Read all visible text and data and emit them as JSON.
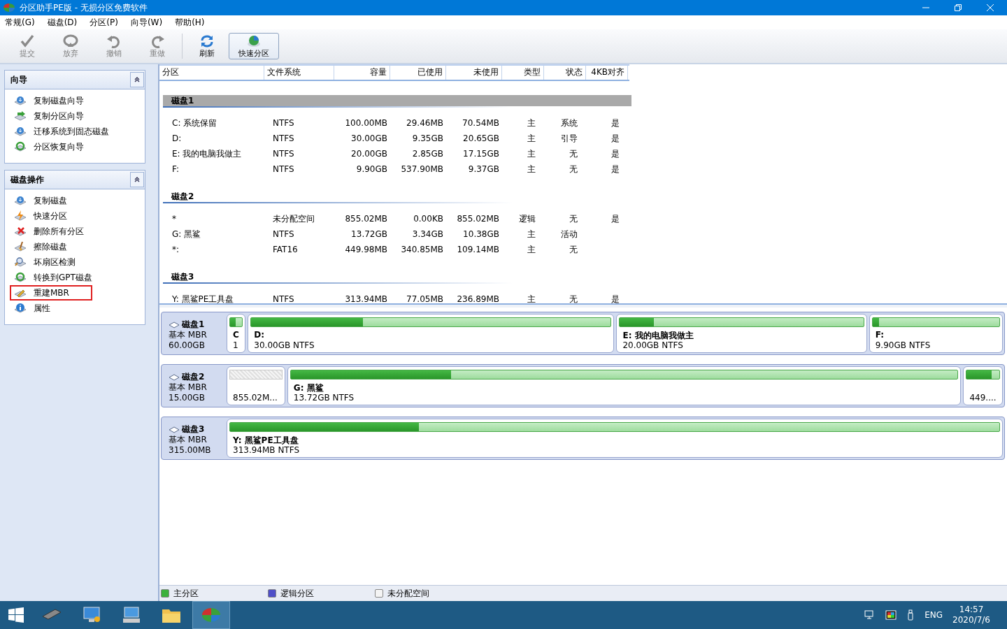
{
  "window": {
    "title": "分区助手PE版 - 无损分区免费软件"
  },
  "menu": [
    "常规(G)",
    "磁盘(D)",
    "分区(P)",
    "向导(W)",
    "帮助(H)"
  ],
  "toolbar": [
    {
      "label": "提交",
      "disabled": true,
      "hovered": false
    },
    {
      "label": "放弃",
      "disabled": true,
      "hovered": false
    },
    {
      "label": "撤销",
      "disabled": true,
      "hovered": false
    },
    {
      "label": "重做",
      "disabled": true,
      "hovered": false
    },
    {
      "label": "刷新",
      "disabled": false,
      "hovered": false
    },
    {
      "label": "快速分区",
      "disabled": false,
      "hovered": true
    }
  ],
  "sidebar": [
    {
      "title": "向导",
      "expanded": true,
      "items": [
        {
          "label": "复制磁盘向导",
          "highlighted": false
        },
        {
          "label": "复制分区向导",
          "highlighted": false
        },
        {
          "label": "迁移系统到固态磁盘",
          "highlighted": false
        },
        {
          "label": "分区恢复向导",
          "highlighted": false
        }
      ]
    },
    {
      "title": "磁盘操作",
      "expanded": true,
      "items": [
        {
          "label": "复制磁盘",
          "highlighted": false
        },
        {
          "label": "快速分区",
          "highlighted": false
        },
        {
          "label": "删除所有分区",
          "highlighted": false
        },
        {
          "label": "擦除磁盘",
          "highlighted": false
        },
        {
          "label": "坏扇区检测",
          "highlighted": false
        },
        {
          "label": "转换到GPT磁盘",
          "highlighted": false
        },
        {
          "label": "重建MBR",
          "highlighted": true
        },
        {
          "label": "属性",
          "highlighted": false
        }
      ]
    }
  ],
  "table": {
    "columns": [
      "分区",
      "文件系统",
      "容量",
      "已使用",
      "未使用",
      "类型",
      "状态",
      "4KB对齐"
    ],
    "groups": [
      {
        "name": "磁盘1",
        "selected": true,
        "rows": [
          [
            "C: 系统保留",
            "NTFS",
            "100.00MB",
            "29.46MB",
            "70.54MB",
            "主",
            "系统",
            "是"
          ],
          [
            "D:",
            "NTFS",
            "30.00GB",
            "9.35GB",
            "20.65GB",
            "主",
            "引导",
            "是"
          ],
          [
            "E: 我的电脑我做主",
            "NTFS",
            "20.00GB",
            "2.85GB",
            "17.15GB",
            "主",
            "无",
            "是"
          ],
          [
            "F:",
            "NTFS",
            "9.90GB",
            "537.90MB",
            "9.37GB",
            "主",
            "无",
            "是"
          ]
        ]
      },
      {
        "name": "磁盘2",
        "selected": false,
        "rows": [
          [
            "*",
            "未分配空间",
            "855.02MB",
            "0.00KB",
            "855.02MB",
            "逻辑",
            "无",
            "是"
          ],
          [
            "G: 黑鲨",
            "NTFS",
            "13.72GB",
            "3.34GB",
            "10.38GB",
            "主",
            "活动",
            ""
          ],
          [
            "*:",
            "FAT16",
            "449.98MB",
            "340.85MB",
            "109.14MB",
            "主",
            "无",
            ""
          ]
        ]
      },
      {
        "name": "磁盘3",
        "selected": false,
        "rows": [
          [
            "Y: 黑鲨PE工具盘",
            "NTFS",
            "313.94MB",
            "77.05MB",
            "236.89MB",
            "主",
            "无",
            "是"
          ]
        ]
      }
    ]
  },
  "disks": [
    {
      "name": "磁盘1",
      "type": "基本 MBR",
      "size": "60.00GB",
      "partitions": [
        {
          "kind": "primary",
          "name": "C",
          "detail": "1",
          "level": 0.45
        },
        {
          "kind": "primary",
          "name": "D:",
          "detail": "30.00GB NTFS",
          "level": 0.31
        },
        {
          "kind": "primary",
          "name": "E: 我的电脑我做主",
          "detail": "20.00GB NTFS",
          "level": 0.14
        },
        {
          "kind": "primary",
          "name": "F:",
          "detail": "9.90GB NTFS",
          "level": 0.05
        }
      ]
    },
    {
      "name": "磁盘2",
      "type": "基本 MBR",
      "size": "15.00GB",
      "partitions": [
        {
          "kind": "unallocated",
          "detail": "855.02M..."
        },
        {
          "kind": "primary",
          "name": "G: 黑鲨",
          "detail": "13.72GB NTFS",
          "level": 0.24
        },
        {
          "kind": "primary",
          "detail": "449....",
          "level": 0.76
        }
      ]
    },
    {
      "name": "磁盘3",
      "type": "基本 MBR",
      "size": "315.00MB",
      "partitions": [
        {
          "kind": "primary",
          "name": "Y: 黑鲨PE工具盘",
          "detail": "313.94MB NTFS",
          "level": 0.245
        }
      ]
    }
  ],
  "legend": [
    {
      "label": "主分区",
      "color": "#3cb13c"
    },
    {
      "label": "逻辑分区",
      "color": "#5050c8"
    },
    {
      "label": "未分配空间",
      "color": "#f4f4f4"
    }
  ],
  "taskbar": {
    "apps": [
      {
        "selected": false
      },
      {
        "selected": false
      },
      {
        "selected": false
      },
      {
        "selected": false
      },
      {
        "selected": true
      }
    ],
    "language": "ENG",
    "time": "14:57",
    "date": "2020/7/6"
  }
}
